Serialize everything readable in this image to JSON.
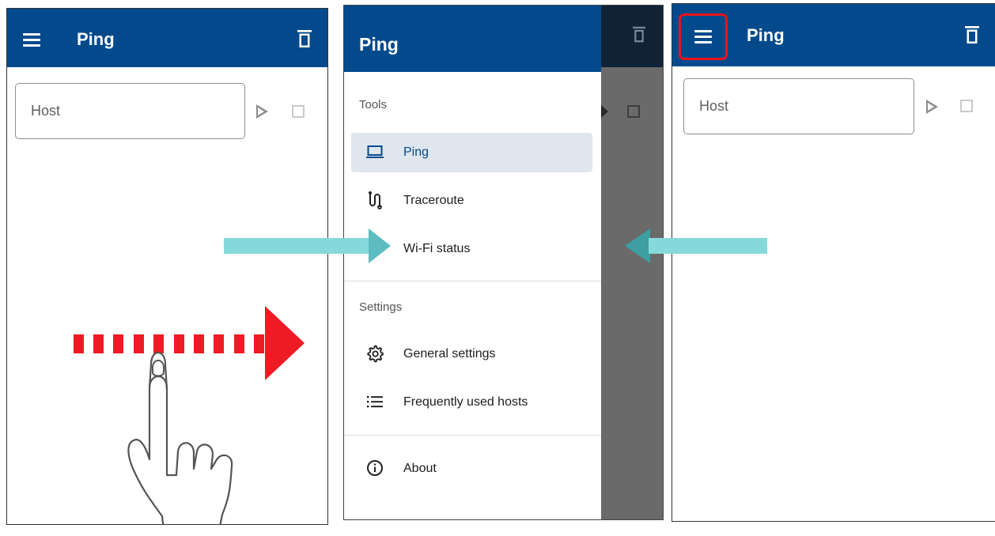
{
  "app": {
    "title": "Ping"
  },
  "host_field": {
    "placeholder": "Host"
  },
  "drawer": {
    "title": "Ping",
    "sections": [
      {
        "label": "Tools"
      },
      {
        "label": "Settings"
      }
    ],
    "tools": [
      {
        "label": "Ping",
        "icon": "laptop-icon",
        "active": true
      },
      {
        "label": "Traceroute",
        "icon": "traceroute-icon"
      },
      {
        "label": "Wi-Fi status",
        "icon": "wifi-icon"
      }
    ],
    "settings": [
      {
        "label": "General settings",
        "icon": "gear-icon"
      },
      {
        "label": "Frequently used hosts",
        "icon": "list-icon"
      }
    ],
    "about": {
      "label": "About",
      "icon": "info-icon"
    }
  },
  "colors": {
    "appbar": "#034a8c",
    "annotation_arrow": "#86d9da",
    "swipe_arrow": "#ee1b24",
    "highlight": "#e8141c"
  }
}
